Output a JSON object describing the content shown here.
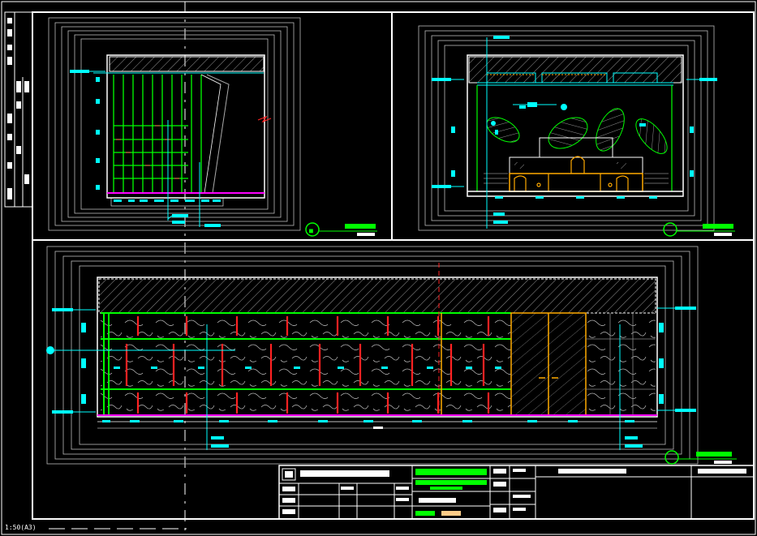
{
  "drawing": {
    "scale_note": "1:50(A3)",
    "colors": {
      "background": "#000000",
      "frame": "#ffffff",
      "tag": "#00ffff",
      "structure": "#00ff00",
      "post": "#ff0000",
      "door": "#ffaa00",
      "floor": "#ff00ff",
      "hatch": "#cccccc"
    }
  }
}
